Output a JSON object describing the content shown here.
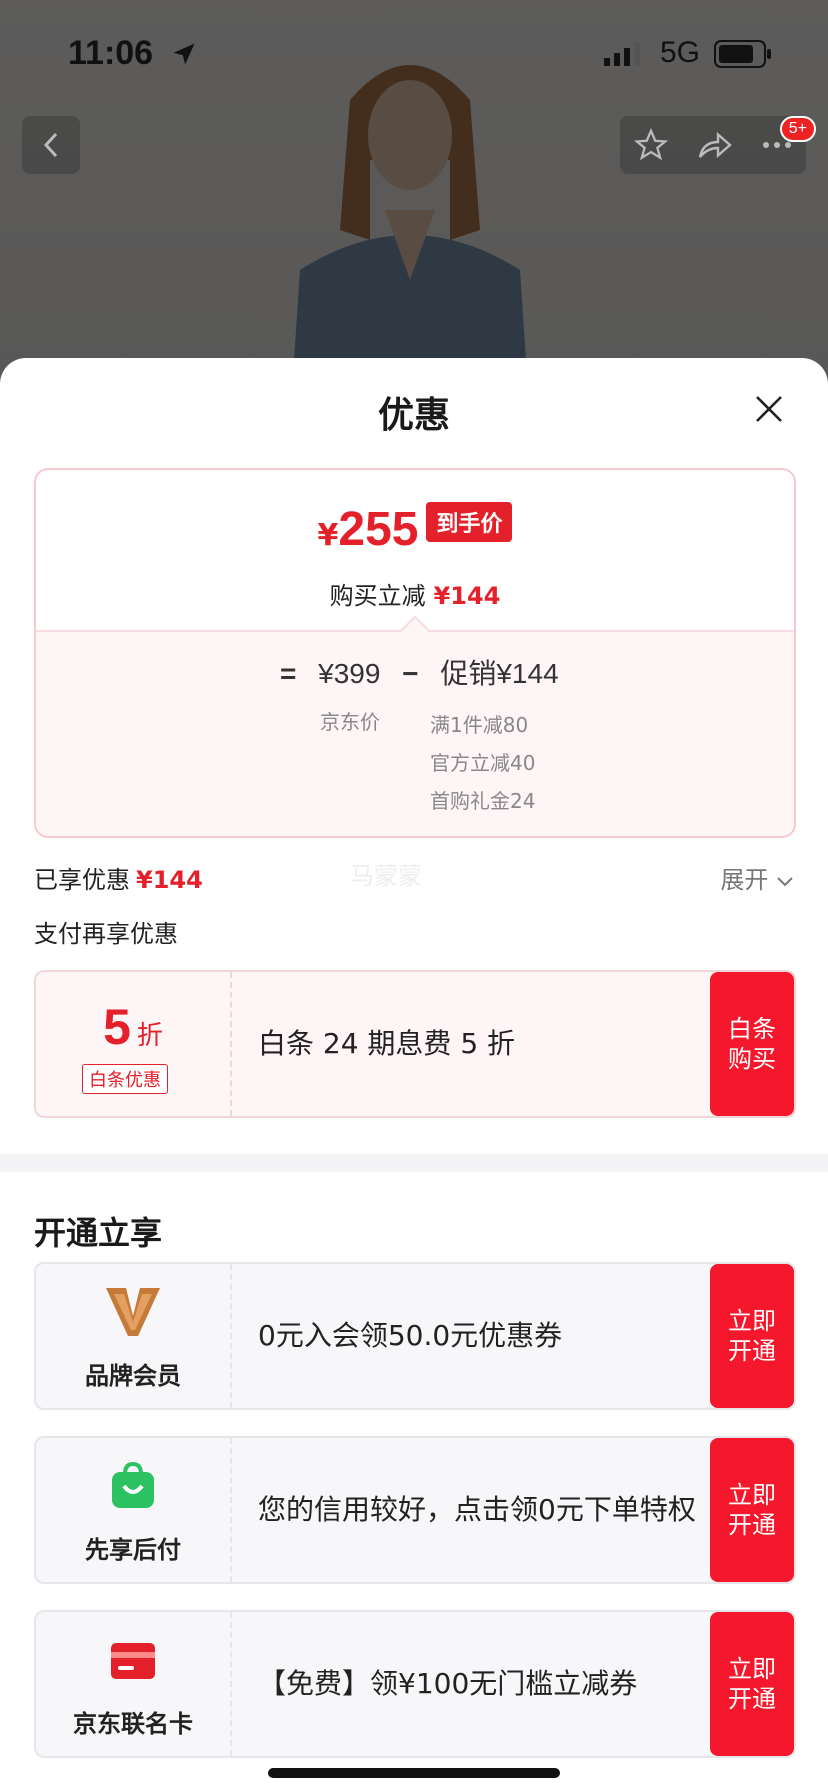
{
  "status_bar": {
    "time": "11:06",
    "network": "5G"
  },
  "header": {
    "cart_badge": "5+"
  },
  "sheet": {
    "title": "优惠",
    "price_card": {
      "yen": "¥",
      "final_price": "255",
      "final_tag": "到手价",
      "buy_reduce_label": "购买立减",
      "buy_reduce_value": "¥144",
      "eq": "=",
      "jd_price": "¥399",
      "minus": "−",
      "promo_total": "促销¥144",
      "jd_price_label": "京东价",
      "promo_items": [
        "满1件减80",
        "官方立减40",
        "首购礼金24"
      ]
    },
    "enjoyed_label": "已享优惠",
    "enjoyed_value": "¥144",
    "watermark": "马蒙蒙",
    "expand_label": "展开",
    "pay_more_label": "支付再享优惠",
    "baitiao": {
      "discount_num": "5",
      "discount_unit": "折",
      "tag": "白条优惠",
      "desc": "白条 24 期息费 5 折",
      "cta": "白条购买"
    },
    "section_title": "开通立享",
    "memberships": [
      {
        "label": "品牌会员",
        "desc": "0元入会领50.0元优惠券",
        "cta": "立即开通",
        "icon": "brand-v-icon"
      },
      {
        "label": "先享后付",
        "desc": "您的信用较好，点击领0元下单特权",
        "cta": "立即开通",
        "icon": "shopping-bag-icon"
      },
      {
        "label": "京东联名卡",
        "desc": "【免费】领¥100无门槛立减券",
        "cta": "立即开通",
        "icon": "credit-card-icon"
      }
    ]
  },
  "colors": {
    "accent": "#e4202a",
    "cta": "#f5172b"
  }
}
